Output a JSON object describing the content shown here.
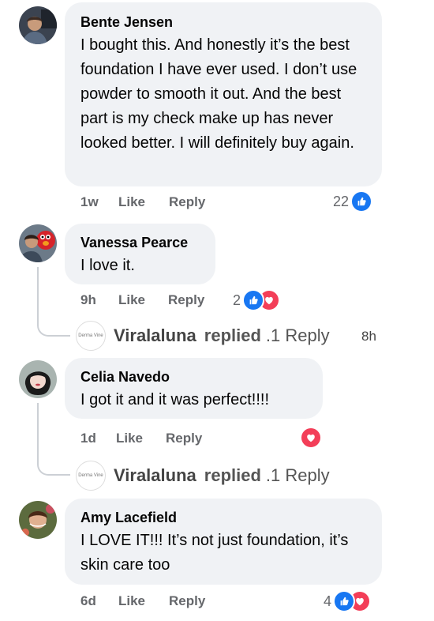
{
  "comments": [
    {
      "author": "Bente Jensen",
      "text": "I bought this. And honestly it’s the best foundation I have ever used. I don’t use powder to smooth it out. And the best part is my check make up has never looked better. I will definitely buy again.",
      "time": "1w",
      "like_label": "Like",
      "reply_label": "Reply",
      "reaction_count": "22",
      "reactions": [
        "like-icon"
      ]
    },
    {
      "author": "Vanessa Pearce",
      "text": "I love it.",
      "time": "9h",
      "like_label": "Like",
      "reply_label": "Reply",
      "reaction_count": "2",
      "reactions": [
        "like-icon",
        "love-icon"
      ],
      "replies": {
        "page_logo_text": "Derma Vine",
        "name": "Viralaluna",
        "replied": "replied",
        "count_text": ".1 Reply",
        "time": "8h"
      }
    },
    {
      "author": "Celia Navedo",
      "text": "I got it and it was perfect!!!!",
      "time": "1d",
      "like_label": "Like",
      "reply_label": "Reply",
      "reactions": [
        "love-icon"
      ],
      "replies": {
        "page_logo_text": "Derma Vine",
        "name": "Viralaluna",
        "replied": "replied",
        "count_text": ".1 Reply"
      }
    },
    {
      "author": "Amy Lacefield",
      "text": "I LOVE IT!!! It’s not just foundation, it’s skin care too",
      "time": "6d",
      "like_label": "Like",
      "reply_label": "Reply",
      "reaction_count": "4",
      "reactions": [
        "like-icon",
        "love-icon"
      ]
    }
  ],
  "colors": {
    "bubble": "#f0f2f5",
    "like_blue": "#1877f2",
    "love_red": "#f33e58",
    "meta_gray": "#65676b"
  }
}
